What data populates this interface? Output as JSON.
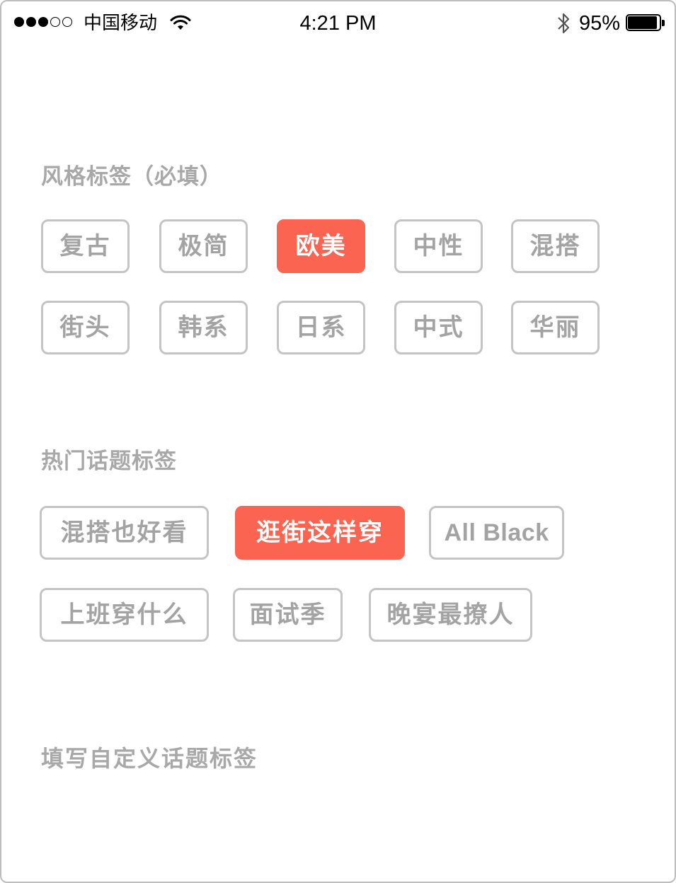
{
  "status_bar": {
    "signal_icon": "signal-strength-icon",
    "carrier": "中国移动",
    "wifi_icon": "wifi-icon",
    "time": "4:21 PM",
    "bluetooth_icon": "bluetooth-icon",
    "battery_percent": "95%",
    "battery_level": 0.95,
    "battery_icon": "battery-icon"
  },
  "style_section": {
    "title": "风格标签（必填）",
    "tags": [
      {
        "label": "复古",
        "selected": false
      },
      {
        "label": "极简",
        "selected": false
      },
      {
        "label": "欧美",
        "selected": true
      },
      {
        "label": "中性",
        "selected": false
      },
      {
        "label": "混搭",
        "selected": false
      },
      {
        "label": "街头",
        "selected": false
      },
      {
        "label": "韩系",
        "selected": false
      },
      {
        "label": "日系",
        "selected": false
      },
      {
        "label": "中式",
        "selected": false
      },
      {
        "label": "华丽",
        "selected": false
      }
    ]
  },
  "hot_section": {
    "title": "热门话题标签",
    "tags": [
      {
        "label": "混搭也好看",
        "selected": false
      },
      {
        "label": "逛街这样穿",
        "selected": true
      },
      {
        "label": "All Black",
        "selected": false
      },
      {
        "label": "上班穿什么",
        "selected": false
      },
      {
        "label": "面试季",
        "selected": false
      },
      {
        "label": "晚宴最撩人",
        "selected": false
      }
    ]
  },
  "custom_section": {
    "placeholder": "填写自定义话题标签",
    "value": ""
  },
  "colors": {
    "accent": "#fa6451",
    "tag_border": "#c4c4c4",
    "muted_text": "#a8a8a8"
  }
}
